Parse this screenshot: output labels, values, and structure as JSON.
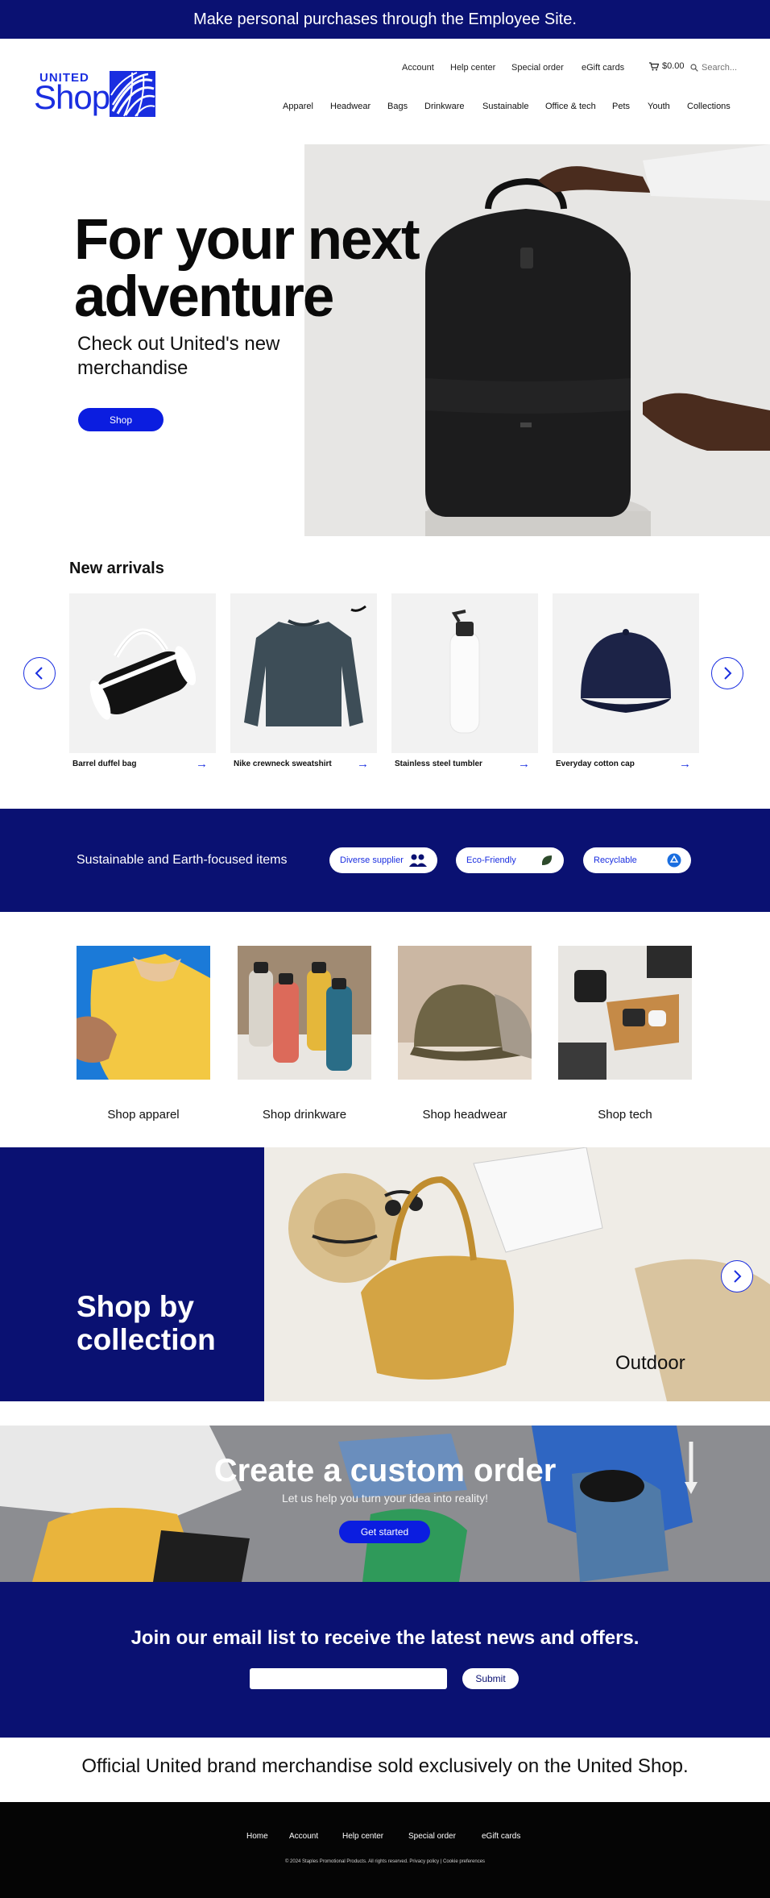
{
  "promo": {
    "text": "Make personal purchases through the Employee Site."
  },
  "header": {
    "logo": {
      "wordmark": "UNITED",
      "shop": "Shop"
    },
    "utility": [
      "Account",
      "Help center",
      "Special order",
      "eGift cards"
    ],
    "cart_total": "$0.00",
    "search_placeholder": "Search...",
    "nav": [
      "Apparel",
      "Headwear",
      "Bags",
      "Drinkware",
      "Sustainable",
      "Office & tech",
      "Pets",
      "Youth",
      "Collections"
    ]
  },
  "hero": {
    "title_line1": "For your next",
    "title_line2": "adventure",
    "subtitle_line1": "Check out United's new",
    "subtitle_line2": "merchandise",
    "cta": "Shop"
  },
  "new_arrivals": {
    "title": "New arrivals",
    "items": [
      {
        "name": "Barrel duffel bag"
      },
      {
        "name": "Nike crewneck sweatshirt"
      },
      {
        "name": "Stainless steel tumbler"
      },
      {
        "name": "Everyday cotton cap"
      }
    ]
  },
  "sustainable": {
    "title": "Sustainable and Earth-focused items",
    "pills": [
      "Diverse supplier",
      "Eco-Friendly",
      "Recyclable"
    ]
  },
  "categories": [
    "Shop apparel",
    "Shop drinkware",
    "Shop headwear",
    "Shop tech"
  ],
  "collection": {
    "title_line1": "Shop by",
    "title_line2": "collection",
    "caption": "Outdoor"
  },
  "custom_order": {
    "title": "Create a custom order",
    "subtitle": "Let us help you turn your idea into reality!",
    "cta": "Get started"
  },
  "email": {
    "title": "Join our email list to receive the latest news and offers.",
    "cta": "Submit"
  },
  "tagline": "Official United brand merchandise sold exclusively on the United Shop.",
  "footer": {
    "links": [
      "Home",
      "Account",
      "Help center",
      "Special order",
      "eGift cards"
    ],
    "copyright": "© 2024 Staples Promotional Products. All rights reserved. Privacy policy | Cookie preferences"
  },
  "colors": {
    "brand_navy": "#0a1172",
    "accent_blue": "#0b1de0"
  }
}
